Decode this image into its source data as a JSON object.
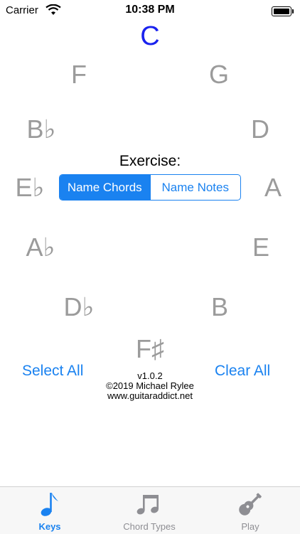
{
  "status_bar": {
    "carrier": "Carrier",
    "time": "10:38 PM"
  },
  "current_key": "C",
  "keys": {
    "g": "G",
    "d": "D",
    "a": "A",
    "e": "E",
    "b": "B",
    "f_sharp": "F♯",
    "d_flat": "D♭",
    "a_flat": "A♭",
    "e_flat": "E♭",
    "b_flat": "B♭",
    "f": "F"
  },
  "exercise": {
    "title": "Exercise:",
    "options": [
      "Name Chords",
      "Name Notes"
    ],
    "selected": "Name Chords"
  },
  "actions": {
    "select_all": "Select All",
    "clear_all": "Clear All"
  },
  "info": {
    "version": "v1.0.2",
    "copyright": "©2019 Michael Rylee",
    "website": "www.guitaraddict.net"
  },
  "tab_bar": {
    "tabs": [
      {
        "label": "Keys",
        "icon": "eighth-note-icon"
      },
      {
        "label": "Chord Types",
        "icon": "beamed-notes-icon"
      },
      {
        "label": "Play",
        "icon": "guitar-icon"
      }
    ],
    "selected": "Keys"
  },
  "colors": {
    "accent": "#1a82f0",
    "current_key": "#1a22ee",
    "inactive_key": "#9b9b9b"
  }
}
